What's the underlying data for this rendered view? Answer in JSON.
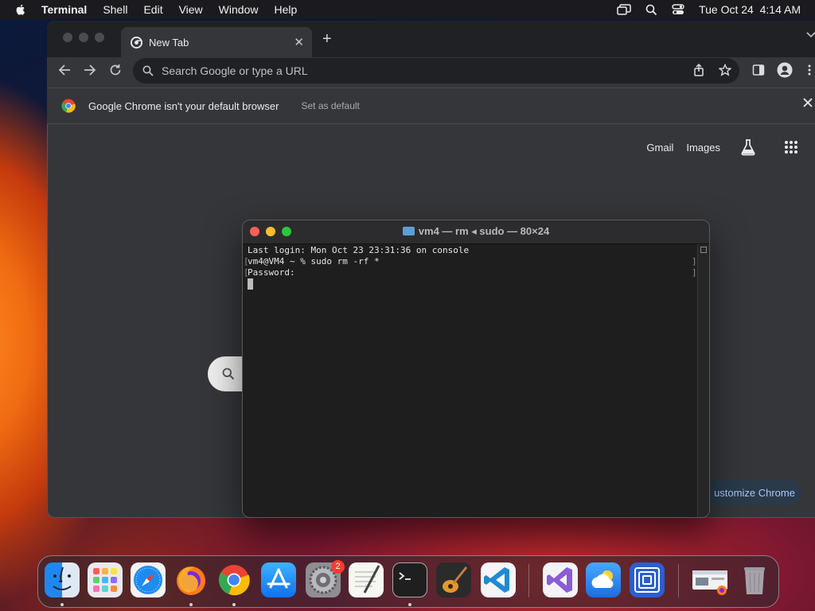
{
  "menubar": {
    "app": "Terminal",
    "items": [
      "Shell",
      "Edit",
      "View",
      "Window",
      "Help"
    ],
    "datetime": "Tue Oct 24  4:14 AM"
  },
  "chrome": {
    "tab_title": "New Tab",
    "omnibox_placeholder": "Search Google or type a URL",
    "infobar_text": "Google Chrome isn't your default browser",
    "infobar_button": "Set as default",
    "links": {
      "gmail": "Gmail",
      "images": "Images"
    },
    "customize_label": "ustomize Chrome"
  },
  "terminal": {
    "title": "vm4 — rm ◂ sudo — 80×24",
    "lines": [
      "Last login: Mon Oct 23 23:31:36 on console",
      "vm4@VM4 ~ % sudo rm -rf *",
      "Password:"
    ]
  },
  "dock": {
    "apps": [
      "finder",
      "launchpad",
      "safari",
      "firefox",
      "chrome",
      "app-store",
      "system-settings",
      "textedit",
      "terminal",
      "garageband",
      "vscode",
      "visual-studio",
      "weather",
      "remote-desktop",
      "preview-thumbnail",
      "trash"
    ],
    "settings_badge": "2"
  },
  "colors": {
    "terminal_bg": "#1e1e1e",
    "chrome_bg": "#35363a",
    "accent": "#a8c7fa"
  }
}
